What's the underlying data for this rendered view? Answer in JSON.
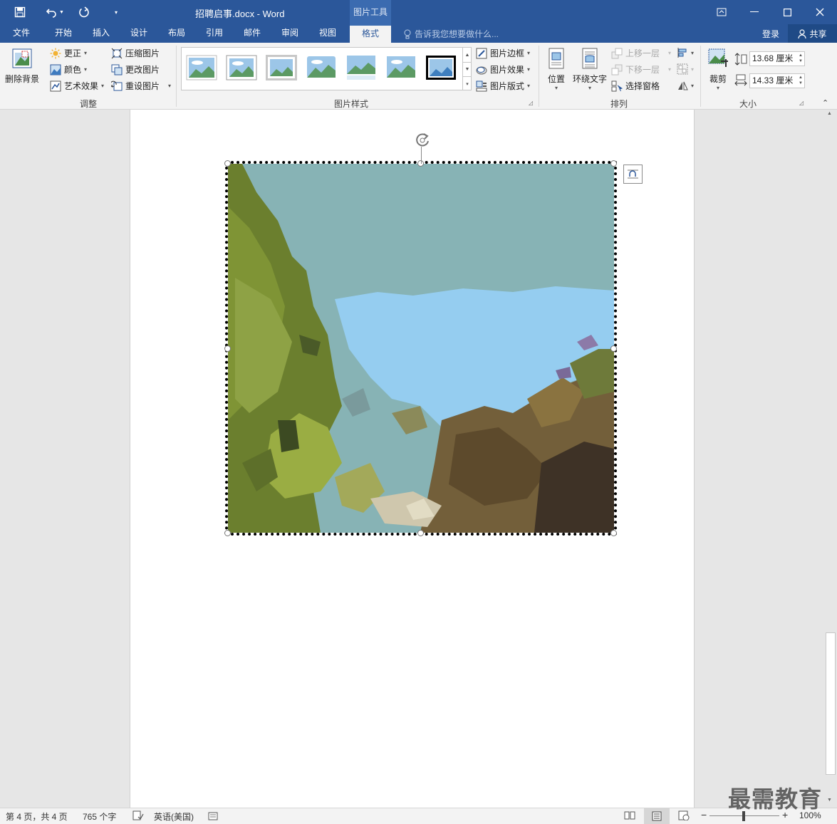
{
  "titlebar": {
    "doc_title": "招聘启事.docx - Word",
    "context_tab": "图片工具"
  },
  "tabs": [
    {
      "label": "文件"
    },
    {
      "label": "开始"
    },
    {
      "label": "插入"
    },
    {
      "label": "设计"
    },
    {
      "label": "布局"
    },
    {
      "label": "引用"
    },
    {
      "label": "邮件"
    },
    {
      "label": "审阅"
    },
    {
      "label": "视图"
    },
    {
      "label": "格式"
    }
  ],
  "tellme": {
    "text": "告诉我您想要做什么..."
  },
  "account": {
    "login": "登录",
    "share": "共享"
  },
  "ribbon": {
    "adjust": {
      "remove_bg": "删除背景",
      "corrections": "更正",
      "color": "颜色",
      "artistic": "艺术效果",
      "compress": "压缩图片",
      "change": "更改图片",
      "reset": "重设图片",
      "label": "调整"
    },
    "styles": {
      "border": "图片边框",
      "effects": "图片效果",
      "layout": "图片版式",
      "label": "图片样式"
    },
    "arrange": {
      "position": "位置",
      "wrap": "环绕文字",
      "forward": "上移一层",
      "backward": "下移一层",
      "pane": "选择窗格",
      "label": "排列"
    },
    "size": {
      "crop": "裁剪",
      "height": "13.68 厘米",
      "width": "14.33 厘米",
      "label": "大小"
    }
  },
  "statusbar": {
    "page": "第 4 页，共 4 页",
    "words": "765 个字",
    "language": "英语(美国)",
    "zoom": "100%"
  },
  "watermark": "最需教育",
  "colors": {
    "accent": "#2b579a",
    "ribbon_bg": "#f3f3f3"
  }
}
